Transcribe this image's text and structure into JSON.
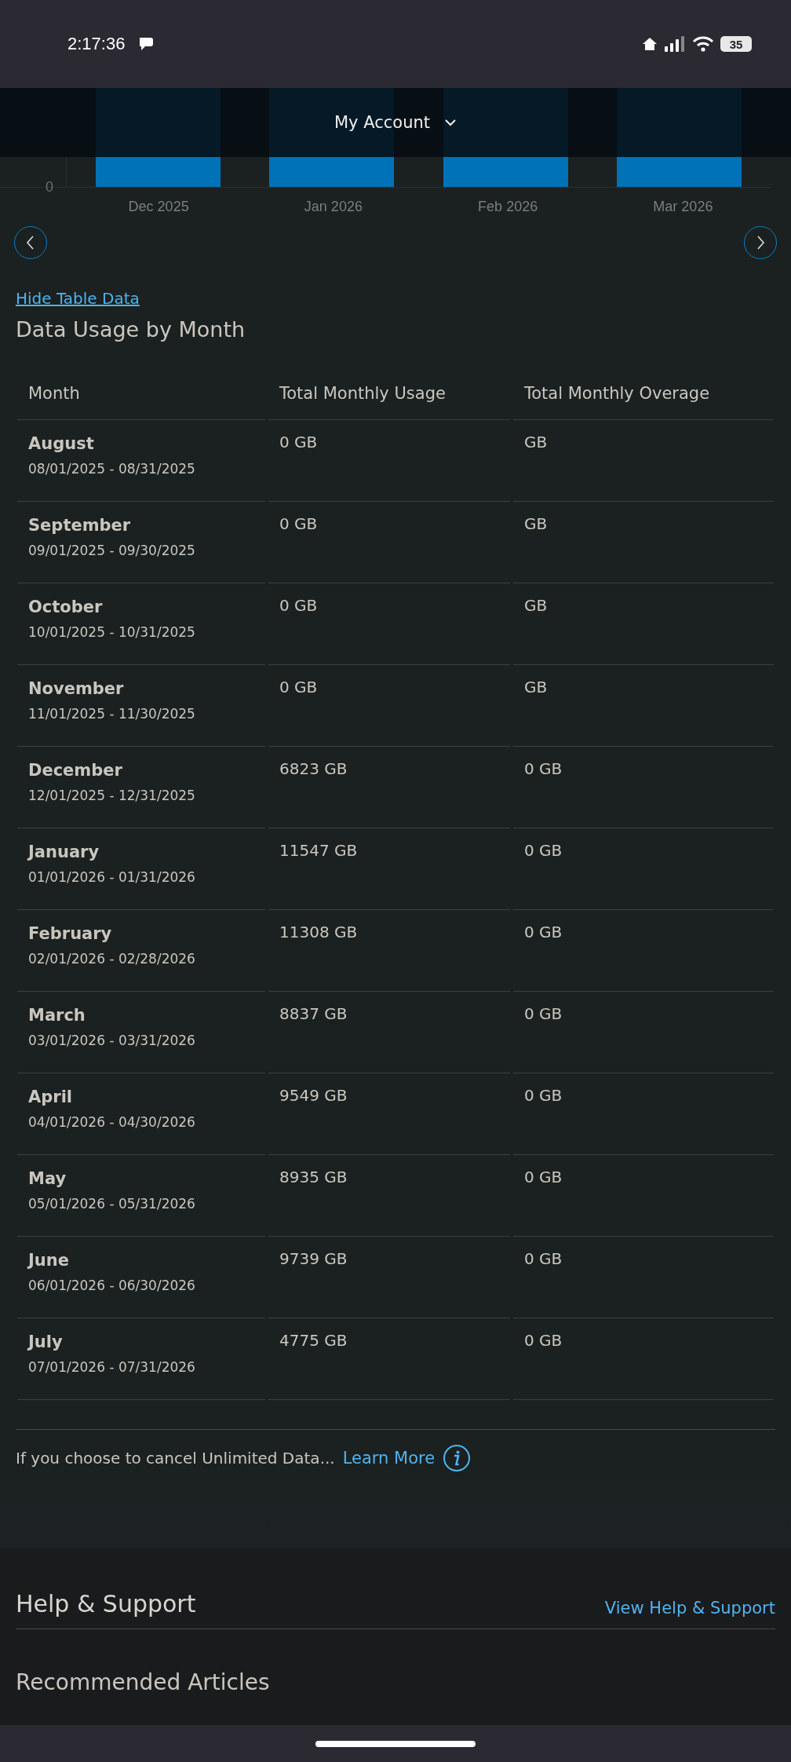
{
  "status_bar": {
    "time": "2:17:36",
    "battery": "35"
  },
  "header": {
    "title": "My Account"
  },
  "chart": {
    "y_labels": [
      "0"
    ],
    "months": [
      "Dec 2025",
      "Jan 2026",
      "Feb 2026",
      "Mar 2026"
    ]
  },
  "hide_table_link": "Hide Table Data",
  "table": {
    "title": "Data Usage by Month",
    "columns": [
      "Month",
      "Total Monthly Usage",
      "Total Monthly Overage"
    ],
    "rows": [
      {
        "month": "August",
        "range": "08/01/2025 - 08/31/2025",
        "usage": "0 GB",
        "overage": "GB"
      },
      {
        "month": "September",
        "range": "09/01/2025 - 09/30/2025",
        "usage": "0 GB",
        "overage": "GB"
      },
      {
        "month": "October",
        "range": "10/01/2025 - 10/31/2025",
        "usage": "0 GB",
        "overage": "GB"
      },
      {
        "month": "November",
        "range": "11/01/2025 - 11/30/2025",
        "usage": "0 GB",
        "overage": "GB"
      },
      {
        "month": "December",
        "range": "12/01/2025 - 12/31/2025",
        "usage": "6823 GB",
        "overage": "0 GB"
      },
      {
        "month": "January",
        "range": "01/01/2026 - 01/31/2026",
        "usage": "11547 GB",
        "overage": "0 GB"
      },
      {
        "month": "February",
        "range": "02/01/2026 - 02/28/2026",
        "usage": "11308 GB",
        "overage": "0 GB"
      },
      {
        "month": "March",
        "range": "03/01/2026 - 03/31/2026",
        "usage": "8837 GB",
        "overage": "0 GB"
      },
      {
        "month": "April",
        "range": "04/01/2026 - 04/30/2026",
        "usage": "9549 GB",
        "overage": "0 GB"
      },
      {
        "month": "May",
        "range": "05/01/2026 - 05/31/2026",
        "usage": "8935 GB",
        "overage": "0 GB"
      },
      {
        "month": "June",
        "range": "06/01/2026 - 06/30/2026",
        "usage": "9739 GB",
        "overage": "0 GB"
      },
      {
        "month": "July",
        "range": "07/01/2026 - 07/31/2026",
        "usage": "4775 GB",
        "overage": "0 GB"
      }
    ]
  },
  "footnote": {
    "text": "If you choose to cancel Unlimited Data...",
    "link": "Learn More"
  },
  "help": {
    "title": "Help & Support",
    "link": "View Help & Support",
    "next_heading": "Recommended Articles"
  }
}
